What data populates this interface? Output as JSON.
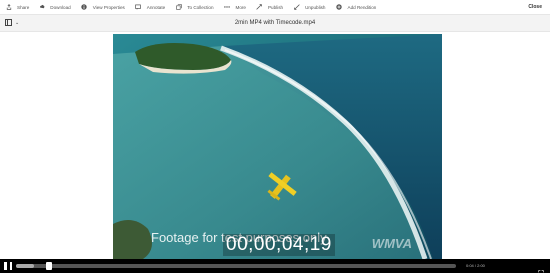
{
  "toolbar": {
    "items": [
      {
        "label": "Share",
        "icon": "share-icon"
      },
      {
        "label": "Download",
        "icon": "download-icon"
      },
      {
        "label": "View Properties",
        "icon": "info-icon"
      },
      {
        "label": "Annotate",
        "icon": "annotate-icon"
      },
      {
        "label": "To Collection",
        "icon": "collection-icon"
      },
      {
        "label": "More",
        "icon": "more-icon"
      },
      {
        "label": "Publish",
        "icon": "publish-icon"
      },
      {
        "label": "Unpublish",
        "icon": "unpublish-icon"
      },
      {
        "label": "Add Rendition",
        "icon": "add-icon"
      }
    ],
    "close_label": "Close"
  },
  "titlebar": {
    "title": "2min MP4 with Timecode.mp4"
  },
  "video": {
    "caption": "Footage for test purposes only",
    "timecode": "00;00;04;19",
    "watermark": "WMVA"
  },
  "player": {
    "progress": 0.04,
    "time_text": "0:04 / 2:00"
  },
  "colors": {
    "toolbar_bg": "#ffffff",
    "titlebar_bg": "#f3f3f3",
    "controls_bg": "#000000",
    "sea": "#1a6f80"
  }
}
